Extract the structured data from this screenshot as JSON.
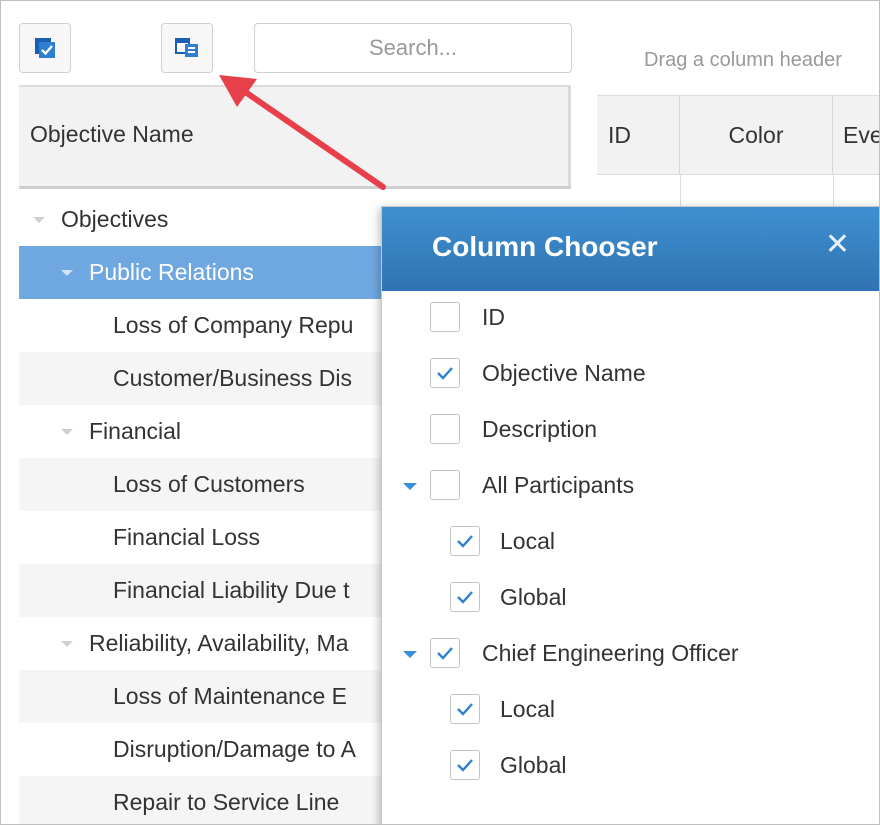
{
  "toolbar": {
    "select_icon": "checkbox-list-icon",
    "column_chooser_icon": "column-chooser-icon",
    "search_placeholder": "Search..."
  },
  "grid": {
    "drag_hint": "Drag a column header",
    "columns": [
      "ID",
      "Color",
      "Eve"
    ]
  },
  "tree": {
    "header": "Objective Name",
    "rows": [
      {
        "label": "Objectives"
      },
      {
        "label": "Public Relations"
      },
      {
        "label": "Loss of Company Repu"
      },
      {
        "label": "Customer/Business Dis"
      },
      {
        "label": "Financial"
      },
      {
        "label": "Loss of Customers"
      },
      {
        "label": "Financial Loss"
      },
      {
        "label": "Financial Liability Due t"
      },
      {
        "label": "Reliability, Availability, Ma"
      },
      {
        "label": "Loss of Maintenance E"
      },
      {
        "label": "Disruption/Damage to A"
      },
      {
        "label": "Repair to Service Line"
      }
    ]
  },
  "column_chooser": {
    "title": "Column Chooser",
    "close_icon": "close-icon",
    "items": [
      {
        "label": "ID",
        "checked": false
      },
      {
        "label": "Objective Name",
        "checked": true
      },
      {
        "label": "Description",
        "checked": false
      },
      {
        "label": "All Participants",
        "checked": false,
        "expandable": true
      },
      {
        "label": "Local",
        "checked": true
      },
      {
        "label": "Global",
        "checked": true
      },
      {
        "label": "Chief Engineering Officer",
        "checked": true,
        "expandable": true
      },
      {
        "label": "Local",
        "checked": true
      },
      {
        "label": "Global",
        "checked": true
      }
    ]
  },
  "colors": {
    "selection": "#6fa8e0",
    "chooser_header": "#3a86c8",
    "check": "#2f7fd0",
    "callout_arrow": "#e8404a"
  }
}
